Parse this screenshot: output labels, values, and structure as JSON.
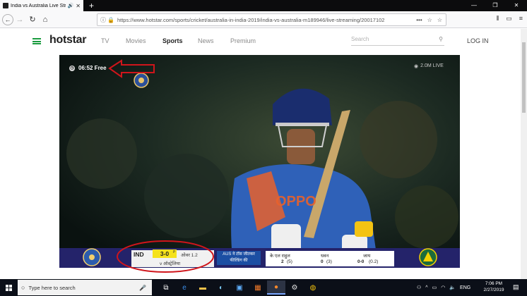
{
  "browser": {
    "tab_title": "India vs Australia Live Strea",
    "tab_close": "✕",
    "new_tab": "+",
    "window_controls": [
      "—",
      "❐",
      "✕"
    ],
    "url": "https://www.hotstar.com/sports/cricket/australia-in-india-2019/india-vs-australia-m189946/live-streaming/20017102",
    "url_icons": [
      "•••",
      "☆",
      "☆"
    ],
    "nav_back": "←",
    "nav_forward": "→",
    "nav_reload": "↻",
    "nav_home": "⌂",
    "right_icons": [
      "⫴",
      "▭",
      "≡"
    ]
  },
  "hotstar": {
    "logo": "hotstar",
    "menu": {
      "tv": "TV",
      "movies": "Movies",
      "sports": "Sports",
      "news": "News",
      "premium": "Premium"
    },
    "search_placeholder": "Search",
    "login": "LOG IN"
  },
  "player": {
    "free_timer": "06:52 Free",
    "viewers": "2.0M LIVE"
  },
  "scoreboard": {
    "team": "IND",
    "score": "3-0",
    "powerplay": "P",
    "overs": "ओवर 1.2",
    "opponent": "v ऑस्ट्रेलिया",
    "toss": "AUS ने टॉस जीतकर फील्डिंग की",
    "batsman1": "के एल राहुल",
    "batsman1_runs": "2",
    "batsman1_balls": "(5)",
    "batsman2": "धवन",
    "batsman2_runs": "0",
    "batsman2_balls": "(3)",
    "bowler": "जाय",
    "bowler_figures": "0-0",
    "bowler_overs": "(0.2)"
  },
  "taskbar": {
    "search_placeholder": "Type here to search",
    "language": "ENG",
    "time": "7:06 PM",
    "date": "2/27/2019"
  },
  "colors": {
    "hotstar_green": "#1a9b3f",
    "annotation_red": "#d0151b",
    "score_yellow": "#f5e21b",
    "scorebar_navy": "#24236a"
  }
}
